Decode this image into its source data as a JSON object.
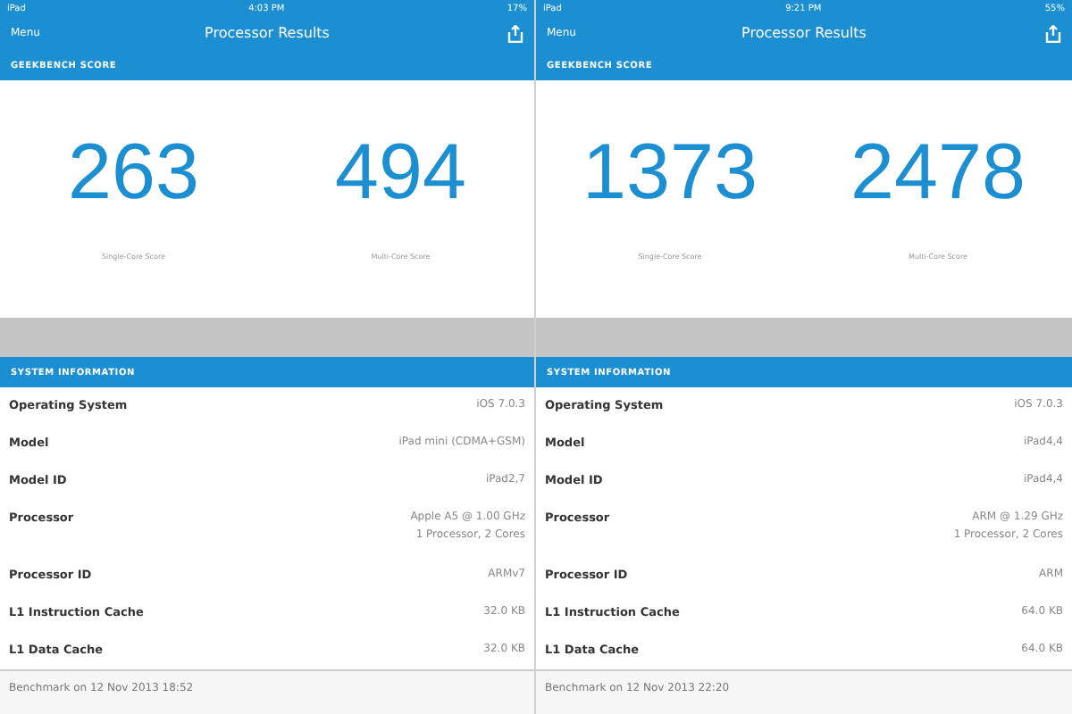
{
  "panes": [
    {
      "status_bar": {
        "device": "iPad",
        "time": "4:03 PM",
        "battery": "17%"
      },
      "nav": {
        "menu": "Menu",
        "title": "Processor Results"
      },
      "score_header": "GEEKBENCH SCORE",
      "scores": [
        {
          "value": "263",
          "label": "Single-Core Score"
        },
        {
          "value": "494",
          "label": "Multi-Core Score"
        }
      ],
      "info_header": "SYSTEM INFORMATION",
      "rows": [
        {
          "label": "Operating System",
          "value": [
            "iOS 7.0.3"
          ]
        },
        {
          "label": "Model",
          "value": [
            "iPad mini (CDMA+GSM)"
          ]
        },
        {
          "label": "Model ID",
          "value": [
            "iPad2,7"
          ]
        },
        {
          "label": "Processor",
          "value": [
            "Apple A5 @ 1.00 GHz",
            "1 Processor, 2 Cores"
          ]
        },
        {
          "label": "Processor ID",
          "value": [
            "ARMv7"
          ]
        },
        {
          "label": "L1 Instruction Cache",
          "value": [
            "32.0 KB"
          ]
        },
        {
          "label": "L1 Data Cache",
          "value": [
            "32.0 KB"
          ]
        }
      ],
      "footer": "Benchmark on 12 Nov 2013 18:52"
    },
    {
      "status_bar": {
        "device": "iPad",
        "time": "9:21 PM",
        "battery": "55%"
      },
      "nav": {
        "menu": "Menu",
        "title": "Processor Results"
      },
      "score_header": "GEEKBENCH SCORE",
      "scores": [
        {
          "value": "1373",
          "label": "Single-Core Score"
        },
        {
          "value": "2478",
          "label": "Multi-Core Score"
        }
      ],
      "info_header": "SYSTEM INFORMATION",
      "rows": [
        {
          "label": "Operating System",
          "value": [
            "iOS 7.0.3"
          ]
        },
        {
          "label": "Model",
          "value": [
            "iPad4,4"
          ]
        },
        {
          "label": "Model ID",
          "value": [
            "iPad4,4"
          ]
        },
        {
          "label": "Processor",
          "value": [
            "ARM @ 1.29 GHz",
            "1 Processor, 2 Cores"
          ]
        },
        {
          "label": "Processor ID",
          "value": [
            "ARM"
          ]
        },
        {
          "label": "L1 Instruction Cache",
          "value": [
            "64.0 KB"
          ]
        },
        {
          "label": "L1 Data Cache",
          "value": [
            "64.0 KB"
          ]
        }
      ],
      "footer": "Benchmark on 12 Nov 2013 22:20"
    }
  ]
}
